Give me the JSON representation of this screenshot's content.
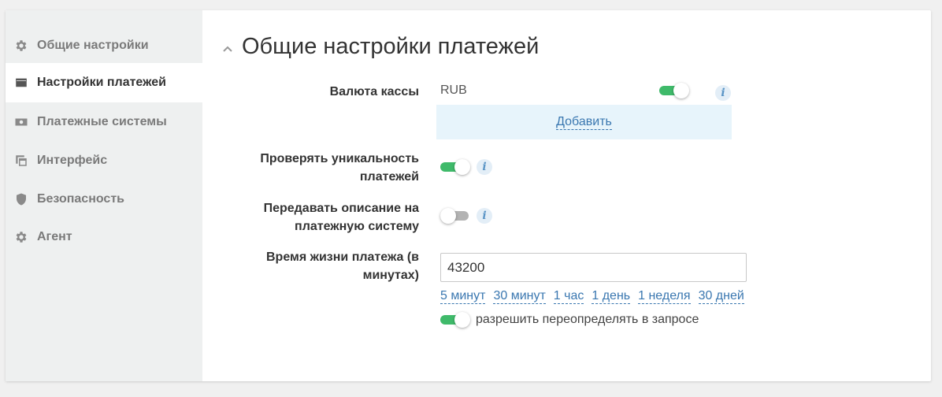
{
  "sidebar": {
    "items": [
      {
        "label": "Общие настройки",
        "icon": "gear-icon",
        "active": false
      },
      {
        "label": "Настройки платежей",
        "icon": "wallet-icon",
        "active": true
      },
      {
        "label": "Платежные системы",
        "icon": "banknote-icon",
        "active": false
      },
      {
        "label": "Интерфейс",
        "icon": "window-icon",
        "active": false
      },
      {
        "label": "Безопасность",
        "icon": "shield-icon",
        "active": false
      },
      {
        "label": "Агент",
        "icon": "gear-icon",
        "active": false
      }
    ]
  },
  "main": {
    "title": "Общие настройки платежей",
    "currency": {
      "label": "Валюта кассы",
      "value": "RUB",
      "enabled": true,
      "add_label": "Добавить"
    },
    "unique_check": {
      "label": "Проверять уникальность платежей",
      "enabled": true
    },
    "send_description": {
      "label": "Передавать описание на платежную систему",
      "enabled": false
    },
    "lifetime": {
      "label": "Время жизни платежа (в минутах)",
      "value": "43200",
      "presets": [
        "5 минут",
        "30 минут",
        "1 час",
        "1 день",
        "1 неделя",
        "30 дней"
      ],
      "override_enabled": true,
      "override_label": "разрешить переопределять в запросе"
    }
  },
  "colors": {
    "accent_green": "#3fba6a",
    "link_blue": "#3a77b0",
    "add_area_bg": "#e7f4fb",
    "sidebar_bg": "#eef0f0"
  }
}
